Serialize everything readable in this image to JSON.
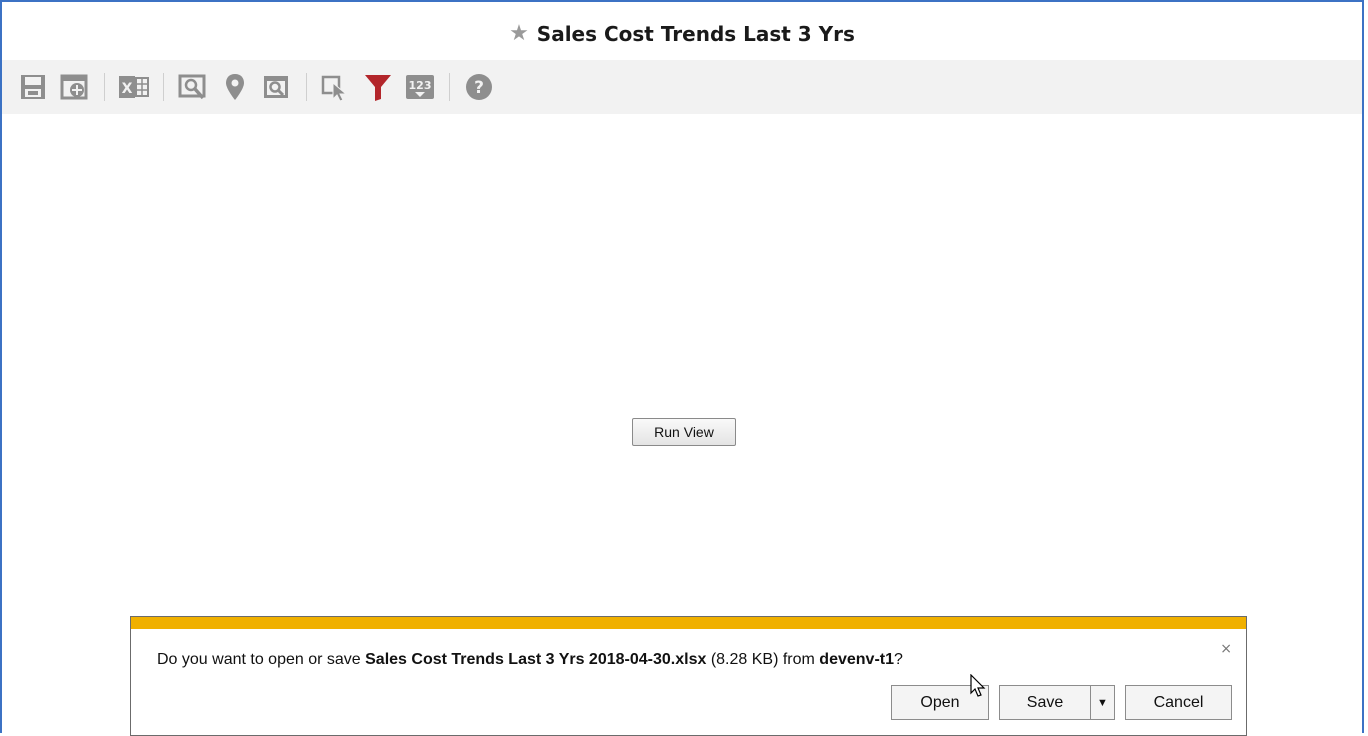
{
  "header": {
    "title": "Sales Cost Trends Last 3 Yrs",
    "star_icon": "favorite-star-icon"
  },
  "toolbar": {
    "buttons": [
      {
        "name": "save-icon",
        "group": 1
      },
      {
        "name": "add-dashboard-icon",
        "group": 1
      },
      {
        "name": "excel-export-icon",
        "group": 2
      },
      {
        "name": "analyze-icon",
        "group": 3
      },
      {
        "name": "map-pin-icon",
        "group": 3
      },
      {
        "name": "preview-icon",
        "group": 3
      },
      {
        "name": "select-pointer-icon",
        "group": 4
      },
      {
        "name": "filter-icon",
        "group": 4,
        "active_color": "#b3262b"
      },
      {
        "name": "number-format-icon",
        "group": 4
      },
      {
        "name": "help-icon",
        "group": 5
      }
    ]
  },
  "main": {
    "run_view_label": "Run View"
  },
  "download_bar": {
    "accent_color": "#f0b000",
    "prefix": "Do you want to open or save ",
    "filename": "Sales Cost Trends Last 3 Yrs 2018-04-30.xlsx",
    "size": "(8.28 KB)",
    "from_text": " from ",
    "host": "devenv-t1",
    "suffix": "?",
    "close_label": "×",
    "open_label": "Open",
    "save_label": "Save",
    "cancel_label": "Cancel"
  },
  "colors": {
    "window_border": "#3c72c4",
    "icon_gray": "#8e8e8e",
    "filter_red": "#b3262b"
  }
}
